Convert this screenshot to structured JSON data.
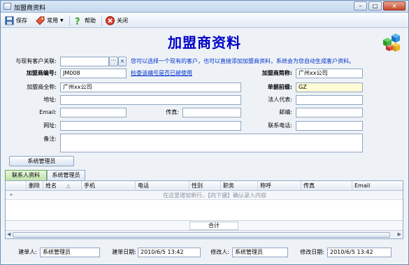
{
  "window": {
    "title": "加盟商资料",
    "buttons": {
      "minimize": "–",
      "maximize": "□",
      "close": "×"
    }
  },
  "toolbar": {
    "save_label": "保存",
    "common_label": "常用",
    "help_label": "帮助",
    "close_label": "关闭"
  },
  "header": {
    "title": "加盟商资料"
  },
  "form": {
    "link_customer_label": "与现有客户关联:",
    "link_customer_value": "",
    "link_hint": "您可以选择一个现有的客户，也可以直接添加加盟商资料，系统会为您自动生成客户资料。",
    "code_label": "加盟商编号:",
    "code_value": "JM008",
    "check_code_link": "检查该编号是否已被使用",
    "short_name_label": "加盟商简称:",
    "short_name_value": "广州xx公司",
    "full_name_label": "加盟商全称:",
    "full_name_value": "广州xx公司",
    "doc_prefix_label": "单据前缀:",
    "doc_prefix_value": "GZ",
    "address_label": "地址:",
    "address_value": "",
    "legal_rep_label": "法人代表:",
    "legal_rep_value": "",
    "email_label": "Email:",
    "email_value": "",
    "fax_label": "传真:",
    "fax_value": "",
    "postcode_label": "邮编:",
    "postcode_value": "",
    "website_label": "网址:",
    "website_value": "",
    "phone_label": "联系电话:",
    "phone_value": "",
    "note_label": "备注:",
    "note_value": "",
    "admin_button": "系统管理员"
  },
  "tabs": [
    "联系人资料",
    "系统管理员"
  ],
  "grid": {
    "columns": [
      "删除",
      "姓名",
      "手机",
      "电话",
      "性别",
      "职务",
      "称呼",
      "传真",
      "Email"
    ],
    "sort_indicator": "△",
    "new_row_marker": "✦",
    "new_row_text": "在这里增加新行，【向下键】确认录入内容",
    "footer_sum": "合计"
  },
  "status": {
    "creator_label": "建单人:",
    "creator_value": "系统管理员",
    "create_date_label": "建单日期:",
    "create_date_value": "2010/6/5 13:42",
    "modifier_label": "修改人:",
    "modifier_value": "系统管理员",
    "modify_date_label": "修改日期:",
    "modify_date_value": "2010/6/5 13:42"
  }
}
